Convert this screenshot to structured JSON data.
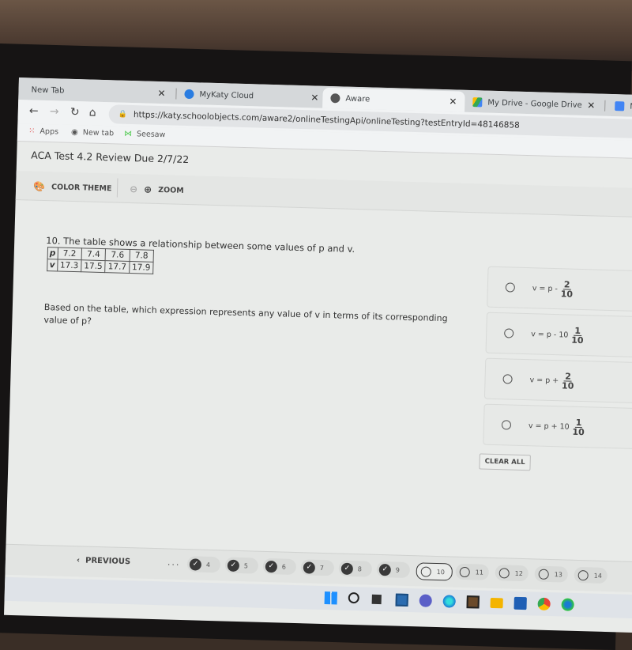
{
  "browser": {
    "tabs": [
      {
        "title": "New Tab",
        "icon": "none"
      },
      {
        "title": "MyKaty Cloud",
        "icon": "cloud-icon"
      },
      {
        "title": "Aware",
        "icon": "globe-icon"
      },
      {
        "title": "My Drive - Google Drive",
        "icon": "google-drive-icon"
      },
      {
        "title": "Nicol",
        "icon": "google-docs-icon"
      }
    ],
    "url": "https://katy.schoolobjects.com/aware2/onlineTestingApi/onlineTesting?testEntryId=48146858",
    "bookmarks": [
      {
        "label": "Apps",
        "icon": "apps-grid-icon"
      },
      {
        "label": "New tab",
        "icon": "globe-icon"
      },
      {
        "label": "Seesaw",
        "icon": "seesaw-icon"
      }
    ]
  },
  "page": {
    "title": "ACA Test 4.2 Review Due 2/7/22",
    "toolbar": {
      "color_theme": "COLOR THEME",
      "zoom": "ZOOM"
    }
  },
  "question": {
    "number_text": "10. The table shows a relationship between some values of p and v.",
    "table": {
      "rows": [
        {
          "header": "p",
          "values": [
            "7.2",
            "7.4",
            "7.6",
            "7.8"
          ]
        },
        {
          "header": "v",
          "values": [
            "17.3",
            "17.5",
            "17.7",
            "17.9"
          ]
        }
      ]
    },
    "prompt": "Based on the table, which expression represents any value of v in terms of its corresponding value of p?",
    "choices": [
      {
        "prefix": "v = p -",
        "numerator": "2",
        "denominator": "10",
        "selected": false
      },
      {
        "prefix": "v = p - 10",
        "numerator": "1",
        "denominator": "10",
        "selected": false
      },
      {
        "prefix": "v = p +",
        "numerator": "2",
        "denominator": "10",
        "selected": false
      },
      {
        "prefix": "v = p + 10",
        "numerator": "1",
        "denominator": "10",
        "selected": false
      }
    ],
    "clear_all": "CLEAR ALL"
  },
  "navigation": {
    "previous": "PREVIOUS",
    "ellipsis": "...",
    "questions": [
      {
        "number": "4",
        "answered": true
      },
      {
        "number": "5",
        "answered": true
      },
      {
        "number": "6",
        "answered": true
      },
      {
        "number": "7",
        "answered": true
      },
      {
        "number": "8",
        "answered": true
      },
      {
        "number": "9",
        "answered": true
      },
      {
        "number": "10",
        "answered": false,
        "current": true
      },
      {
        "number": "11",
        "answered": false
      },
      {
        "number": "12",
        "answered": false
      },
      {
        "number": "13",
        "answered": false
      },
      {
        "number": "14",
        "answered": false
      }
    ]
  },
  "taskbar": {
    "icons": [
      "windows-start-icon",
      "search-icon",
      "task-view-icon",
      "widgets-icon",
      "teams-chat-icon",
      "edge-icon",
      "minecraft-icon",
      "file-explorer-icon",
      "microsoft-store-icon",
      "chrome-icon",
      "edge-dev-icon"
    ]
  }
}
